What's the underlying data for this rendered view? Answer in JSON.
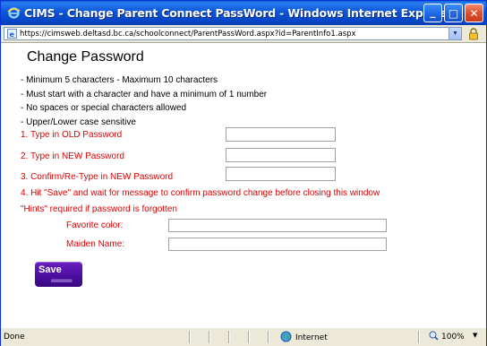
{
  "window": {
    "title": "CIMS - Change Parent Connect PassWord - Windows Internet Explorer",
    "minimize_glyph": "_",
    "maximize_glyph": "□",
    "close_glyph": "✕"
  },
  "address": {
    "url": "https://cimsweb.deltasd.bc.ca/schoolconnect/ParentPassWord.aspx?id=ParentInfo1.aspx"
  },
  "page": {
    "heading": "Change Password",
    "rules": [
      "- Minimum 5 characters - Maximum 10 characters",
      "- Must start with a character and have a minimum of 1 number",
      "- No spaces or special characters allowed",
      "- Upper/Lower case sensitive"
    ],
    "steps": {
      "old_label": "1. Type in OLD Password",
      "new_label": "2. Type in NEW Password",
      "confirm_label": "3. Confirm/Re-Type in NEW Password",
      "save_instruction": "4. Hit \"Save\" and wait for message to confirm password change before closing this window"
    },
    "hints": {
      "intro": "\"Hints\" required if password is forgotten",
      "favorite_color_label": "Favorite color:",
      "maiden_name_label": "Maiden Name:"
    },
    "save_label": "Save"
  },
  "status": {
    "left_text": "Done",
    "zone_text": "Internet",
    "zoom_text": "100%"
  },
  "colors": {
    "title_blue": "#0b56d8",
    "instruction_red": "#e00000",
    "save_purple": "#4b0fa0"
  },
  "icons": {
    "title": "ie-logo-icon",
    "address": "ie-page-icon",
    "security": "lock-icon",
    "zone": "globe-icon",
    "zoom": "zoom-icon"
  }
}
